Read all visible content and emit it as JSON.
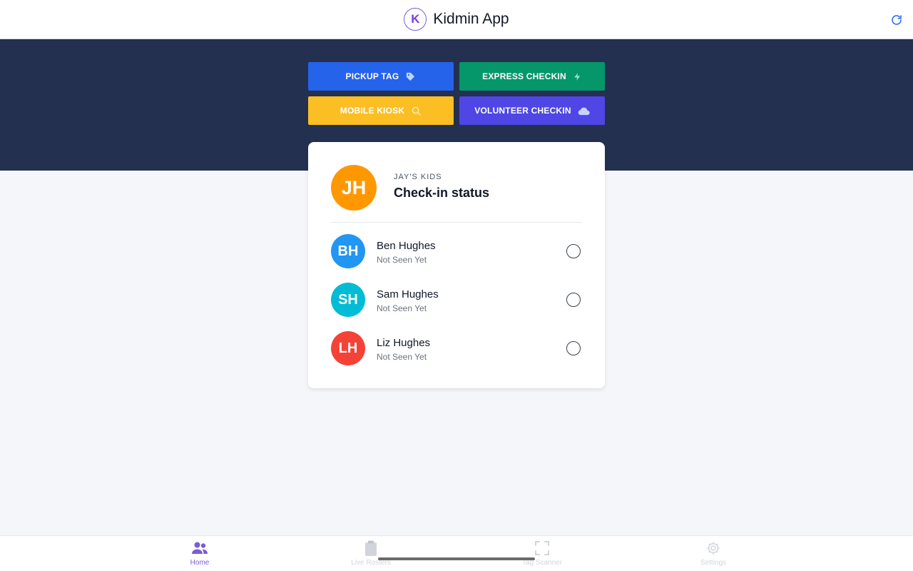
{
  "header": {
    "logo_letter": "K",
    "title": "Kidmin App",
    "refresh_icon": "refresh-icon"
  },
  "actions": [
    {
      "label": "PICKUP TAG",
      "icon": "tag-icon",
      "color": "#2563eb"
    },
    {
      "label": "EXPRESS CHECKIN",
      "icon": "lightning-icon",
      "color": "#059669"
    },
    {
      "label": "MOBILE KIOSK",
      "icon": "search-icon",
      "color": "#fbbf24"
    },
    {
      "label": "VOLUNTEER CHECKIN",
      "icon": "cloud-icon",
      "color": "#4f46e5"
    }
  ],
  "card": {
    "group_initials": "JH",
    "group_color": "#ff9800",
    "eyebrow": "JAY'S KIDS",
    "title": "Check-in status",
    "children": [
      {
        "initials": "BH",
        "name": "Ben Hughes",
        "status": "Not Seen Yet",
        "color": "#2196f3"
      },
      {
        "initials": "SH",
        "name": "Sam Hughes",
        "status": "Not Seen Yet",
        "color": "#00bcd4"
      },
      {
        "initials": "LH",
        "name": "Liz Hughes",
        "status": "Not Seen Yet",
        "color": "#f44336"
      }
    ]
  },
  "tabs": [
    {
      "label": "Home",
      "icon": "people-icon",
      "active": true
    },
    {
      "label": "Live Rosters",
      "icon": "clipboard-icon",
      "active": false
    },
    {
      "label": "Tag Scanner",
      "icon": "scan-icon",
      "active": false
    },
    {
      "label": "Settings",
      "icon": "gear-icon",
      "active": false
    }
  ],
  "colors": {
    "hero_bg": "#23304f",
    "page_bg": "#f5f6fa",
    "accent": "#7c5cd6",
    "tab_inactive": "#d1d5db"
  }
}
